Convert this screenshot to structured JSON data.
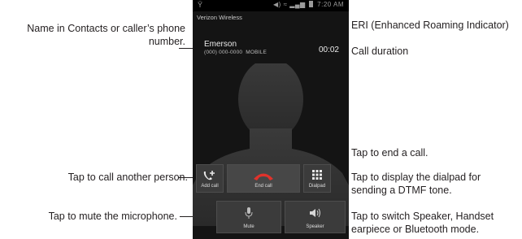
{
  "callouts": {
    "name_line1": "Name in Contacts or caller’s phone",
    "name_line2": "number.",
    "eri": "ERI (Enhanced Roaming Indicator)",
    "duration": "Call duration",
    "end_call": "Tap to end a call.",
    "add_call": "Tap to call another person.",
    "dialpad_line1": "Tap to display the dialpad for",
    "dialpad_line2": "sending a DTMF tone.",
    "mute": "Tap to mute the microphone.",
    "speaker_line1": "Tap to switch Speaker, Handset",
    "speaker_line2": "earpiece or Bluetooth mode."
  },
  "phone": {
    "status": {
      "time": "7:20 AM",
      "left_icon": "signal-glyph"
    },
    "carrier": "Verizon Wireless",
    "contact_name": "Emerson",
    "contact_number": "(000) 000-0000",
    "contact_type": "MOBILE",
    "duration": "00:02",
    "buttons": {
      "add_call": "Add call",
      "end_call": "End call",
      "dialpad": "Dialpad",
      "mute": "Mute",
      "speaker": "Speaker"
    }
  },
  "colors": {
    "end_call_icon": "#e0322b",
    "screen_bg": "#141414",
    "button_bg": "#3b3b3b"
  }
}
